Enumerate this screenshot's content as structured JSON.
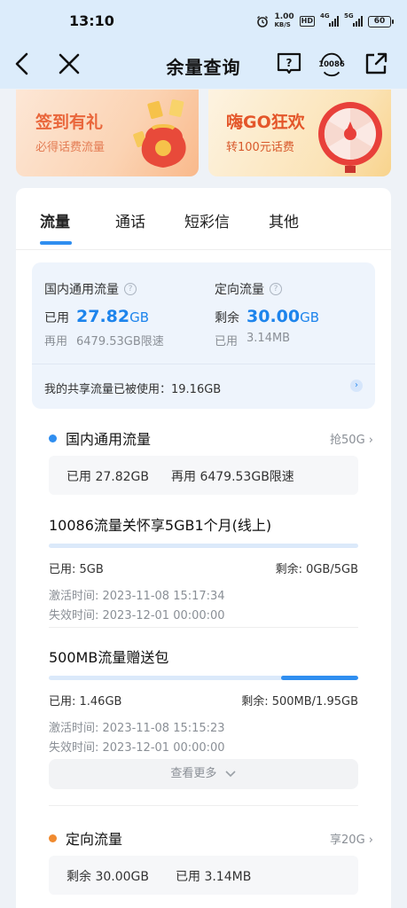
{
  "status_bar": {
    "time": "13:10",
    "speed_value": "1.00",
    "speed_unit": "KB/S",
    "hd": "HD",
    "net1": "4G",
    "net2": "5G",
    "battery": "60"
  },
  "navbar": {
    "title": "余量查询",
    "service_number": "10086"
  },
  "banners": [
    {
      "title": "签到有礼",
      "subtitle": "必得话费流量"
    },
    {
      "title": "嗨GO狂欢",
      "subtitle": "转100元话费"
    }
  ],
  "tabs": [
    "流量",
    "通话",
    "短彩信",
    "其他"
  ],
  "summary": {
    "domestic": {
      "label": "国内通用流量",
      "used_prefix": "已用",
      "used_value": "27.82",
      "used_unit": "GB",
      "sub_prefix": "再用",
      "sub_value": "6479.53GB限速"
    },
    "directed": {
      "label": "定向流量",
      "remain_prefix": "剩余",
      "remain_value": "30.00",
      "remain_unit": "GB",
      "sub_prefix": "已用",
      "sub_value": "3.14MB"
    },
    "share_text": "我的共享流量已被使用：19.16GB"
  },
  "domestic_section": {
    "title": "国内通用流量",
    "link": "抢50G",
    "dot_color": "#2f8ef0",
    "box_used": "已用 27.82GB",
    "box_more": "再用 6479.53GB限速"
  },
  "packages": [
    {
      "title": "10086流量关怀享5GB1个月(线上)",
      "used": "已用: 5GB",
      "remain": "剩余: 0GB/5GB",
      "remaining_fraction": 0.0,
      "activated": "激活时间: 2023-11-08 15:17:34",
      "expires": "失效时间: 2023-12-01 00:00:00"
    },
    {
      "title": "500MB流量赠送包",
      "used": "已用: 1.46GB",
      "remain": "剩余: 500MB/1.95GB",
      "remaining_fraction": 0.25,
      "activated": "激活时间: 2023-11-08 15:15:23",
      "expires": "失效时间: 2023-12-01 00:00:00"
    }
  ],
  "more_button": "查看更多",
  "directed_section": {
    "title": "定向流量",
    "link": "享20G",
    "dot_color": "#f08a2f",
    "box_remain": "剩余 30.00GB",
    "box_used": "已用 3.14MB"
  }
}
